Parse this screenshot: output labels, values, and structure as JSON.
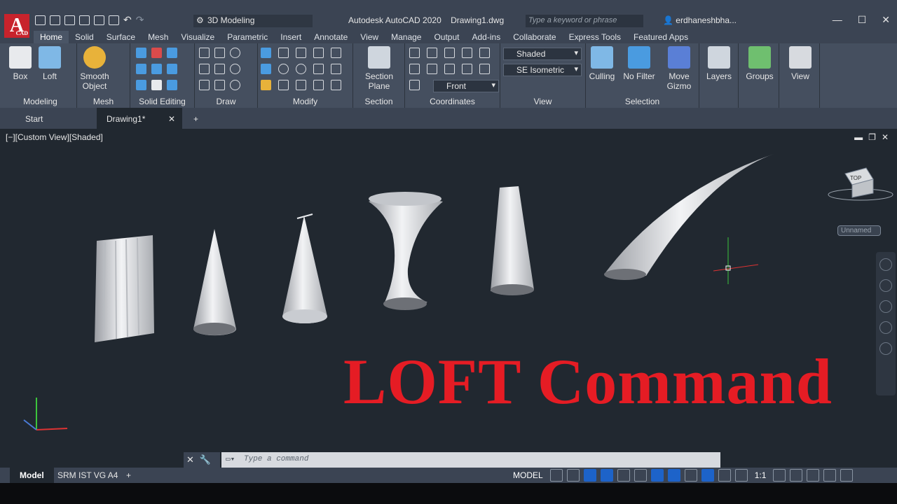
{
  "app": {
    "logo_letter": "A",
    "logo_badge": "CAD",
    "title": "Autodesk AutoCAD 2020",
    "filename": "Drawing1.dwg",
    "workspace": "3D Modeling",
    "search_placeholder": "Type a keyword or phrase",
    "user": "erdhaneshbha..."
  },
  "menu_tabs": [
    "Home",
    "Solid",
    "Surface",
    "Mesh",
    "Visualize",
    "Parametric",
    "Insert",
    "Annotate",
    "View",
    "Manage",
    "Output",
    "Add-ins",
    "Collaborate",
    "Express Tools",
    "Featured Apps"
  ],
  "ribbon": {
    "modeling": {
      "title": "Modeling",
      "box": "Box",
      "loft": "Loft"
    },
    "mesh": {
      "title": "Mesh",
      "smooth_object": "Smooth Object"
    },
    "solid_editing": {
      "title": "Solid Editing"
    },
    "draw": {
      "title": "Draw"
    },
    "modify": {
      "title": "Modify"
    },
    "section": {
      "title": "Section",
      "section_plane": "Section Plane"
    },
    "coordinates": {
      "title": "Coordinates"
    },
    "view": {
      "title": "View",
      "visual_style": "Shaded",
      "view_preset": "SE Isometric",
      "ucs_view": "Front"
    },
    "selection": {
      "title": "Selection",
      "culling": "Culling",
      "no_filter": "No Filter",
      "move_gizmo": "Move Gizmo"
    },
    "layers": "Layers",
    "groups": "Groups",
    "view_panel": "View"
  },
  "doc_tabs": [
    "Start",
    "Drawing1*"
  ],
  "viewport_label": "[−][Custom View][Shaded]",
  "viewcube_face": "TOP",
  "named_view": "Unnamed",
  "headline": "LOFT Command",
  "command_placeholder": "Type a command",
  "layout_tabs": [
    "Model",
    "SRM IST VG A4"
  ],
  "status": {
    "model": "MODEL",
    "scale": "1:1"
  },
  "colors": {
    "accent_red": "#e51c24",
    "ribbon_bg": "#454f5f",
    "canvas_bg": "#212830",
    "status_on": "#1d63c9"
  }
}
